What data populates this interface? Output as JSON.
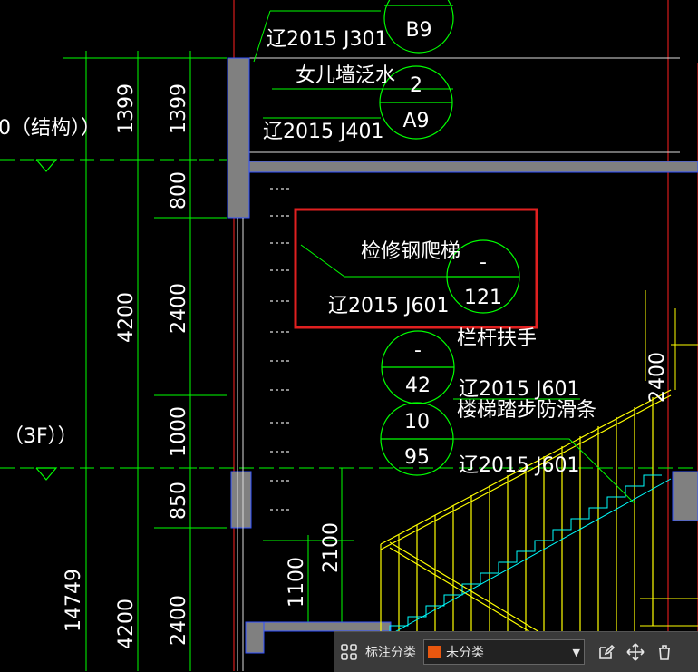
{
  "drawing": {
    "ref_a": "辽2015 J301",
    "bubble_a": "B9",
    "note_parapet": "女儿墙泛水",
    "bubble_b_top": "2",
    "bubble_b_bottom": "A9",
    "ref_b": "辽2015 J401",
    "level_struct": "0（结构））",
    "dim_1399_a": "1399",
    "dim_1399_b": "1399",
    "dim_800": "800",
    "dim_4200_a": "4200",
    "dim_2400_a": "2400",
    "dim_1000": "1000",
    "level_3f": "（3F））",
    "dim_850": "850",
    "dim_2100": "2100",
    "dim_1100": "1100",
    "dim_14749": "14749",
    "dim_4200_b": "4200",
    "dim_2400_b": "2400",
    "dim_2400_c": "2400",
    "note_ladder": "检修钢爬梯",
    "bubble_c_top": "-",
    "bubble_c_bottom": "121",
    "ref_c": "辽2015 J601",
    "note_railing": "栏杆扶手",
    "bubble_d_top": "-",
    "bubble_d_bottom": "42",
    "ref_d": "辽2015 J601",
    "note_antislip": "楼梯踏步防滑条",
    "bubble_e_top": "10",
    "bubble_e_bottom": "95",
    "ref_e": "辽2015 J601"
  },
  "toolbar": {
    "label": "标注分类",
    "select_value": "未分类",
    "swatch_color": "#e8570f"
  },
  "colors": {
    "highlight": "#e02020",
    "dimension": "#00ff00",
    "wall": "#808080",
    "stair": "#ffff00",
    "axis": "#ff2020"
  }
}
